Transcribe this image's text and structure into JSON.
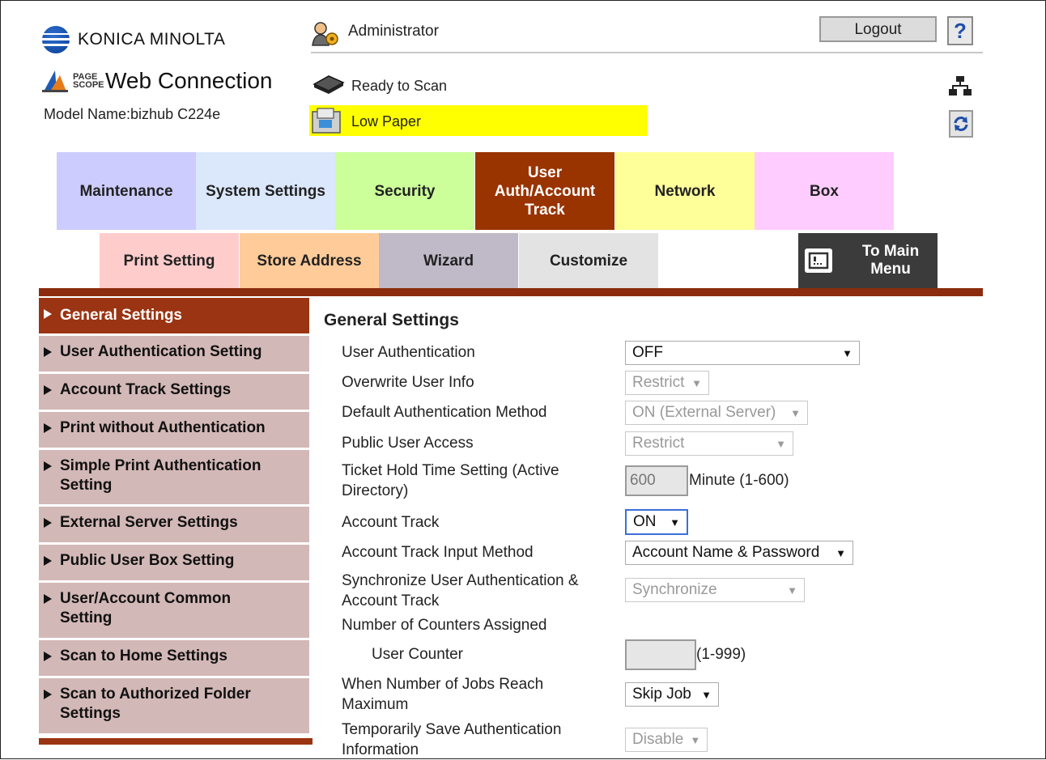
{
  "header": {
    "brand": "KONICA MINOLTA",
    "product_small": "PAGE SCOPE",
    "product": "Web Connection",
    "model": "Model Name:bizhub C224e",
    "user": "Administrator",
    "logout": "Logout",
    "help": "?",
    "status": "Ready to Scan",
    "warning": "Low Paper",
    "warning_color": "#ffff00"
  },
  "tabs": [
    {
      "label": "Maintenance",
      "color": "#ccccff"
    },
    {
      "label": "System Settings",
      "color": "#dbe7fb"
    },
    {
      "label": "Security",
      "color": "#ccff99"
    },
    {
      "label": "User Auth/Account Track",
      "color": "#993300",
      "active": true
    },
    {
      "label": "Network",
      "color": "#ffff99"
    },
    {
      "label": "Box",
      "color": "#ffccff"
    }
  ],
  "subtabs": [
    {
      "label": "Print Setting",
      "color": "#ffcccc"
    },
    {
      "label": "Store Address",
      "color": "#ffcc99"
    },
    {
      "label": "Wizard",
      "color": "#c0b9c8"
    },
    {
      "label": "Customize",
      "color": "#e3e3e3"
    }
  ],
  "to_main_menu": "To Main Menu",
  "sidebar": {
    "items": [
      {
        "label": "General Settings"
      },
      {
        "label": "User Authentication Setting"
      },
      {
        "label": "Account Track Settings"
      },
      {
        "label": "Print without Authentication"
      },
      {
        "label": "Simple Print Authentication Setting"
      },
      {
        "label": "External Server Settings"
      },
      {
        "label": "Public User Box Setting"
      },
      {
        "label": "User/Account Common Setting"
      },
      {
        "label": "Scan to Home Settings"
      },
      {
        "label": "Scan to Authorized Folder Settings"
      }
    ]
  },
  "form": {
    "title": "General Settings",
    "fields": {
      "user_auth": {
        "label": "User Authentication",
        "value": "OFF"
      },
      "overwrite": {
        "label": "Overwrite User Info",
        "value": "Restrict"
      },
      "default_method": {
        "label": "Default Authentication Method",
        "value": "ON (External Server)"
      },
      "public_access": {
        "label": "Public User Access",
        "value": "Restrict"
      },
      "ticket_hold": {
        "label": "Ticket Hold Time Setting (Active Directory)",
        "value": "600",
        "unit": "Minute (1-600)"
      },
      "account_track": {
        "label": "Account Track",
        "value": "ON"
      },
      "input_method": {
        "label": "Account Track Input Method",
        "value": "Account Name & Password"
      },
      "sync": {
        "label": "Synchronize User Authentication & Account Track",
        "value": "Synchronize"
      },
      "counters": {
        "label": "Number of Counters Assigned"
      },
      "user_counter": {
        "label": "User Counter",
        "value": "",
        "unit": "(1-999)"
      },
      "jobs_max": {
        "label": "When Number of Jobs Reach Maximum",
        "value": "Skip Job"
      },
      "temp_save": {
        "label": "Temporarily Save Authentication Information",
        "value": "Disable"
      }
    }
  }
}
